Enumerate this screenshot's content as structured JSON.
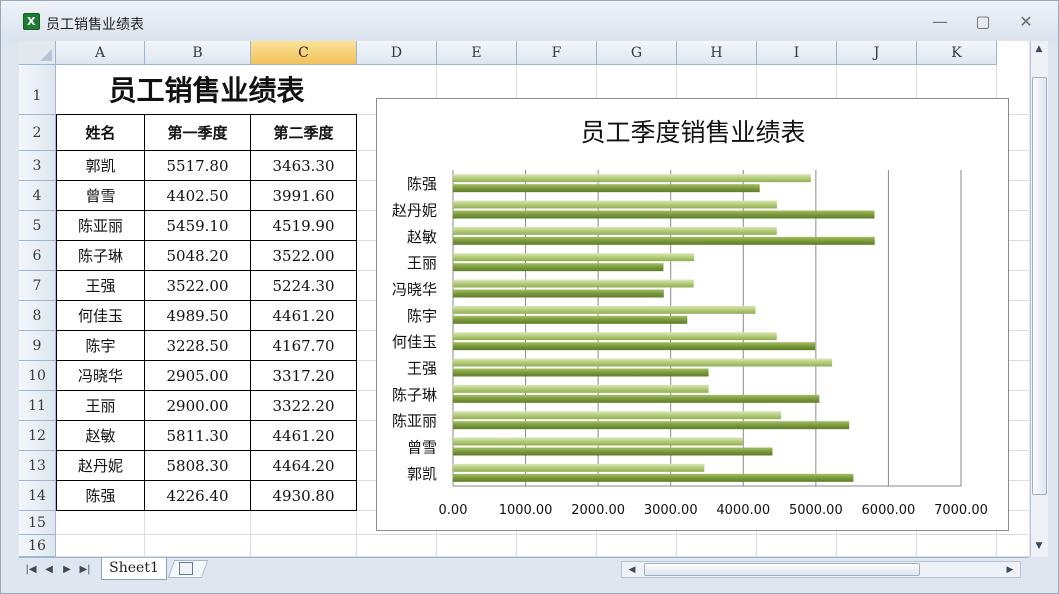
{
  "window": {
    "title": "员工销售业绩表",
    "minimize": "—",
    "maximize": "▢",
    "close": "✕"
  },
  "columns": [
    "A",
    "B",
    "C",
    "D",
    "E",
    "F",
    "G",
    "H",
    "I",
    "J",
    "K"
  ],
  "active_column": "C",
  "rows": [
    "1",
    "2",
    "3",
    "4",
    "5",
    "6",
    "7",
    "8",
    "9",
    "10",
    "11",
    "12",
    "13",
    "14",
    "15",
    "16"
  ],
  "table": {
    "title": "员工销售业绩表",
    "headers": [
      "姓名",
      "第一季度",
      "第二季度"
    ],
    "records": [
      [
        "郭凯",
        "5517.80",
        "3463.30"
      ],
      [
        "曾雪",
        "4402.50",
        "3991.60"
      ],
      [
        "陈亚丽",
        "5459.10",
        "4519.90"
      ],
      [
        "陈子琳",
        "5048.20",
        "3522.00"
      ],
      [
        "王强",
        "3522.00",
        "5224.30"
      ],
      [
        "何佳玉",
        "4989.50",
        "4461.20"
      ],
      [
        "陈宇",
        "3228.50",
        "4167.70"
      ],
      [
        "冯晓华",
        "2905.00",
        "3317.20"
      ],
      [
        "王丽",
        "2900.00",
        "3322.20"
      ],
      [
        "赵敏",
        "5811.30",
        "4461.20"
      ],
      [
        "赵丹妮",
        "5808.30",
        "4464.20"
      ],
      [
        "陈强",
        "4226.40",
        "4930.80"
      ]
    ]
  },
  "chart_data": {
    "type": "bar",
    "orientation": "horizontal",
    "title": "员工季度销售业绩表",
    "categories": [
      "郭凯",
      "曾雪",
      "陈亚丽",
      "陈子琳",
      "王强",
      "何佳玉",
      "陈宇",
      "冯晓华",
      "王丽",
      "赵敏",
      "赵丹妮",
      "陈强"
    ],
    "series": [
      {
        "values": [
          5517.8,
          4402.5,
          5459.1,
          5048.2,
          3522.0,
          4989.5,
          3228.5,
          2905.0,
          2900.0,
          5811.3,
          5808.3,
          4226.4
        ],
        "color": "#7a9a3c"
      },
      {
        "values": [
          3463.3,
          3991.6,
          4519.9,
          3522.0,
          5224.3,
          4461.2,
          4167.7,
          3317.2,
          3322.2,
          4461.2,
          4464.2,
          4930.8
        ],
        "color": "#b4cc78"
      }
    ],
    "x_ticks": [
      "0.00",
      "1000.00",
      "2000.00",
      "3000.00",
      "4000.00",
      "5000.00",
      "6000.00",
      "7000.00"
    ],
    "xlim": [
      0,
      7000
    ],
    "grid": true,
    "legend": "none"
  },
  "sheet_tabs": {
    "active": "Sheet1"
  },
  "colors": {
    "bar_dark": "#7a9a3c",
    "bar_light": "#b4cc78",
    "header_active": "#f2c25a",
    "grid": "#dadcdd"
  }
}
